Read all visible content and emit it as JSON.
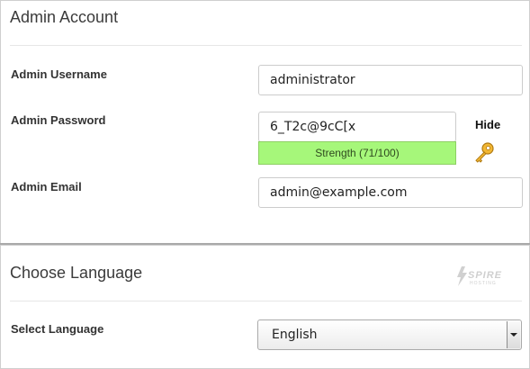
{
  "admin_account": {
    "title": "Admin Account",
    "username_label": "Admin Username",
    "username_value": "administrator",
    "password_label": "Admin Password",
    "password_value": "6_T2c@9cC[x",
    "strength_text": "Strength (71/100)",
    "strength_score": 71,
    "hide_label": "Hide",
    "email_label": "Admin Email",
    "email_value": "admin@example.com"
  },
  "language": {
    "title": "Choose Language",
    "select_label": "Select Language",
    "selected": "English",
    "logo_text": "SPIRE",
    "logo_subtext": "HOSTING"
  },
  "icons": {
    "generate_password": "key-icon",
    "dropdown": "chevron-down-icon"
  },
  "colors": {
    "strength_bar": "#a6f77a",
    "key_icon": "#e2a21b"
  }
}
